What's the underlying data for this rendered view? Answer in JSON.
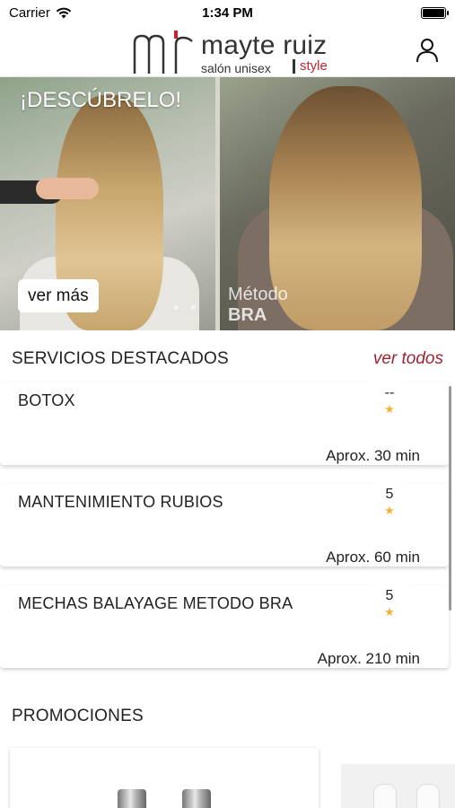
{
  "status_bar": {
    "carrier": "Carrier",
    "time": "1:34 PM",
    "battery_level": 1.0
  },
  "header": {
    "logo_name": "mayte ruiz",
    "logo_sub": "salón unisex",
    "logo_style": "style",
    "logo_mark": "mr"
  },
  "hero": {
    "title": "¡DESCÚBRELO!",
    "cta": "ver más",
    "caption_line1": "Método",
    "caption_line2": "BRA"
  },
  "featured": {
    "title": "SERVICIOS DESTACADOS",
    "see_all": "ver todos",
    "items": [
      {
        "name": "BOTOX",
        "rating": "--",
        "duration": "Aprox. 30 min"
      },
      {
        "name": "MANTENIMIENTO RUBIOS",
        "rating": "5",
        "duration": "Aprox. 60 min"
      },
      {
        "name": "MECHAS BALAYAGE METODO BRA",
        "rating": "5",
        "duration": "Aprox. 210 min"
      }
    ]
  },
  "promotions": {
    "title": "PROMOCIONES"
  },
  "icons": {
    "signal": "signal-icon",
    "wifi": "wifi-icon",
    "battery": "battery-icon",
    "user": "user-icon",
    "star": "star-icon"
  },
  "colors": {
    "accent": "#9d2430",
    "star": "#f2b233"
  }
}
